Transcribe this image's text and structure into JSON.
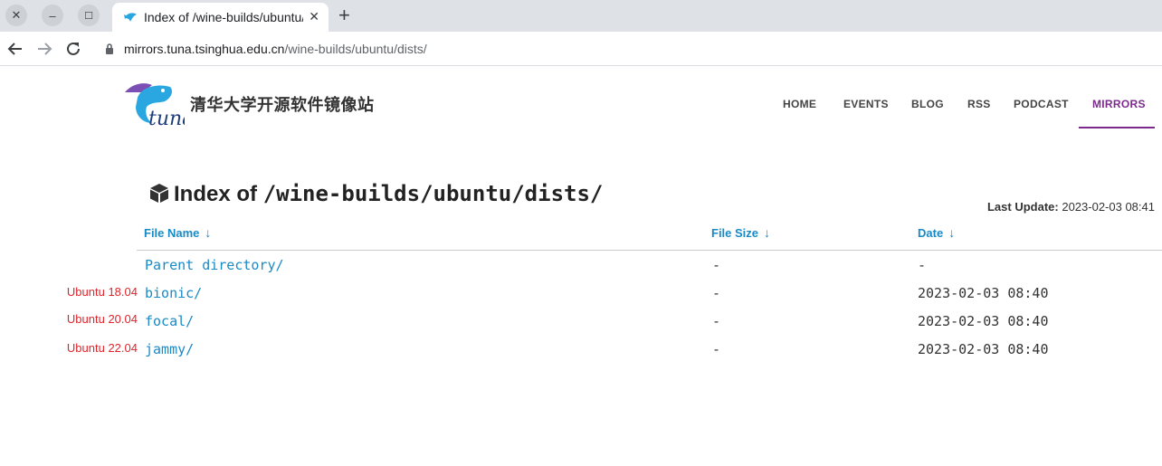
{
  "browser": {
    "tab_title": "Index of /wine-builds/ubuntu/dists/",
    "url_host": "mirrors.tuna.tsinghua.edu.cn",
    "url_path": "/wine-builds/ubuntu/dists/",
    "window_buttons": [
      "close-icon",
      "minimize-icon",
      "maximize-icon"
    ]
  },
  "site": {
    "logo_text": "tuna",
    "title": "清华大学开源软件镜像站",
    "nav": [
      "HOME",
      "EVENTS",
      "BLOG",
      "RSS",
      "PODCAST",
      "MIRRORS"
    ],
    "active_nav": "MIRRORS",
    "accent_color": "#7b2a8c",
    "link_color": "#1a8ac6"
  },
  "listing": {
    "heading_prefix": "Index of",
    "heading_path": "/wine-builds/ubuntu/dists/",
    "last_update_label": "Last Update:",
    "last_update_value": "2023-02-03 08:41",
    "columns": [
      "File Name",
      "File Size",
      "Date"
    ],
    "sort_arrow": "↓",
    "rows": [
      {
        "name": "Parent directory/",
        "size": "-",
        "date": "-"
      },
      {
        "name": "bionic/",
        "size": "-",
        "date": "2023-02-03 08:40"
      },
      {
        "name": "focal/",
        "size": "-",
        "date": "2023-02-03 08:40"
      },
      {
        "name": "jammy/",
        "size": "-",
        "date": "2023-02-03 08:40"
      }
    ]
  },
  "annotations": {
    "note_color": "#e0242b",
    "bionic": "Ubuntu 18.04",
    "focal": "Ubuntu 20.04",
    "jammy": "Ubuntu 22.04"
  }
}
